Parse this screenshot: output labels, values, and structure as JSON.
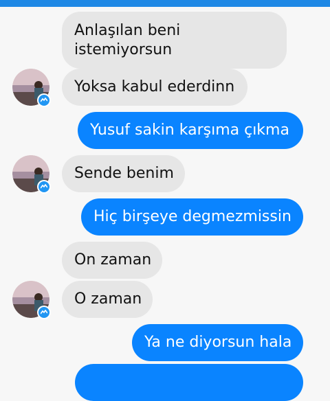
{
  "colors": {
    "accent": "#1e88e5",
    "outgoing_bubble": "#0a84ff",
    "incoming_bubble": "#e6e6e6",
    "background": "#f7f7f7"
  },
  "contact": {
    "avatar_icon": "profile-photo-icon",
    "badge_icon": "messenger-badge-icon"
  },
  "messages": [
    {
      "dir": "in",
      "text": "Anlaşılan beni istemiyorsun"
    },
    {
      "dir": "in",
      "text": "Yoksa kabul ederdinn"
    },
    {
      "dir": "out",
      "text": "Yusuf sakin karşıma çıkma"
    },
    {
      "dir": "in",
      "text": "Sende benim"
    },
    {
      "dir": "out",
      "text": "Hiç birşeye degmezmissin"
    },
    {
      "dir": "in",
      "text": "On zaman"
    },
    {
      "dir": "in",
      "text": "O zaman"
    },
    {
      "dir": "out",
      "text": "Ya ne diyorsun hala"
    },
    {
      "dir": "out",
      "text": ""
    }
  ]
}
